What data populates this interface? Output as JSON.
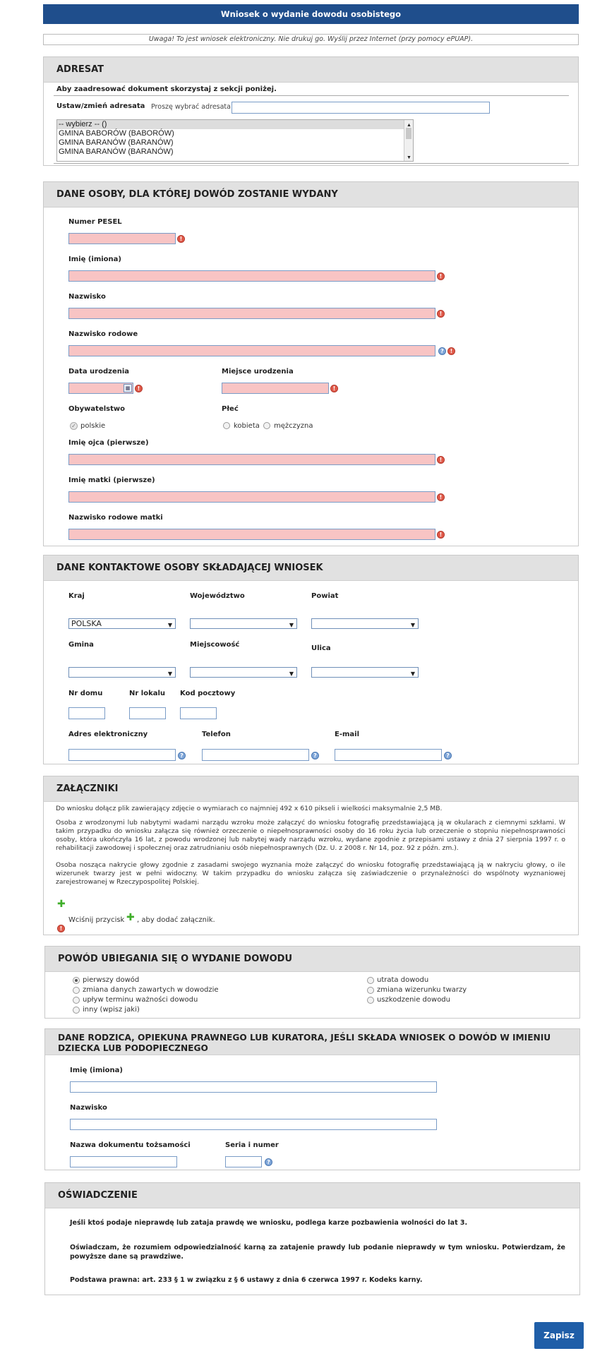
{
  "title": "Wniosek o wydanie dowodu osobistego",
  "notice": "Uwaga! To jest wniosek elektroniczny. Nie drukuj go. Wyślij przez Internet (przy pomocy ePUAP).",
  "adresat": {
    "header": "ADRESAT",
    "hint": "Aby zaadresować dokument skorzystaj z sekcji poniżej.",
    "label": "Ustaw/zmień adresata",
    "placeholder": "Proszę wybrać adresata",
    "options": [
      "-- wybierz -- ()",
      "GMINA BABORÓW (BABORÓW)",
      "GMINA BARANÓW (BARANÓW)",
      "GMINA BARANÓW (BARANÓW)"
    ]
  },
  "person": {
    "header": "DANE OSOBY, DLA KTÓREJ DOWÓD ZOSTANIE WYDANY",
    "pesel": "Numer PESEL",
    "first_name": "Imię (imiona)",
    "last_name": "Nazwisko",
    "family_name": "Nazwisko rodowe",
    "birth_date": "Data urodzenia",
    "birth_place": "Miejsce urodzenia",
    "citizenship": "Obywatelstwo",
    "citizenship_value": "polskie",
    "sex": "Płeć",
    "sex_female": "kobieta",
    "sex_male": "mężczyzna",
    "father": "Imię ojca (pierwsze)",
    "mother": "Imię matki (pierwsze)",
    "mother_family": "Nazwisko rodowe matki"
  },
  "contact": {
    "header": "DANE KONTAKTOWE OSOBY SKŁADAJĄCEJ WNIOSEK",
    "country": "Kraj",
    "country_value": "POLSKA",
    "voivodeship": "Województwo",
    "county": "Powiat",
    "commune": "Gmina",
    "locality": "Miejscowość",
    "street": "Ulica",
    "house_no": "Nr domu",
    "flat_no": "Nr lokalu",
    "postal": "Kod pocztowy",
    "eaddress": "Adres elektroniczny",
    "phone": "Telefon",
    "email": "E-mail"
  },
  "attachments": {
    "header": "ZAŁĄCZNIKI",
    "p1": "Do wniosku dołącz plik zawierający zdjęcie o wymiarach co najmniej 492 x 610 pikseli i wielkości maksymalnie 2,5 MB.",
    "p2": "Osoba z wrodzonymi lub nabytymi wadami narządu wzroku może załączyć do wniosku fotografię przedstawiającą ją w okularach z ciemnymi szkłami. W takim przypadku do wniosku załącza się również orzeczenie o niepełnosprawności osoby do 16 roku życia lub orzeczenie o stopniu niepełnosprawności osoby, która ukończyła 16 lat, z powodu wrodzonej lub nabytej wady narządu wzroku, wydane zgodnie z przepisami ustawy z dnia 27 sierpnia 1997 r. o rehabilitacji zawodowej i społecznej oraz zatrudnianiu osób niepełnosprawnych (Dz. U. z 2008 r. Nr 14, poz. 92 z późn. zm.).",
    "p3": "Osoba nosząca nakrycie głowy zgodnie z zasadami swojego wyznania może załączyć do wniosku fotografię przedstawiającą ją w nakryciu głowy, o ile wizerunek twarzy jest w pełni widoczny. W takim przypadku do wniosku załącza się zaświadczenie o przynależności do wspólnoty wyznaniowej zarejestrowanej w Rzeczypospolitej Polskiej.",
    "add_pre": "Wciśnij przycisk",
    "add_post": ", aby dodać załącznik."
  },
  "reason": {
    "header": "POWÓD UBIEGANIA SIĘ O WYDANIE DOWODU",
    "left": [
      "pierwszy dowód",
      "zmiana danych zawartych w dowodzie",
      "upływ terminu ważności dowodu",
      "inny (wpisz jaki)"
    ],
    "right": [
      "utrata dowodu",
      "zmiana wizerunku twarzy",
      "uszkodzenie dowodu"
    ]
  },
  "parent": {
    "header1": "DANE RODZICA, OPIEKUNA PRAWNEGO LUB KURATORA, JEŚLI SKŁADA WNIOSEK O DOWÓD W IMIENIU",
    "header2": "DZIECKA LUB PODOPIECZNEGO",
    "first_name": "Imię (imiona)",
    "last_name": "Nazwisko",
    "doc_name": "Nazwa dokumentu tożsamości",
    "doc_no": "Seria i numer"
  },
  "declaration": {
    "header": "OŚWIADCZENIE",
    "l1": "Jeśli ktoś podaje nieprawdę lub zataja prawdę we wniosku, podlega karze pozbawienia wolności do lat 3.",
    "l2": "Oświadczam, że rozumiem odpowiedzialność karną za zatajenie prawdy lub podanie nieprawdy w tym wniosku. Potwierdzam, że powyższe dane są prawdziwe.",
    "l3": "Podstawa prawna: art. 233 § 1 w związku z § 6 ustawy z dnia 6 czerwca 1997 r. Kodeks karny."
  },
  "save_label": "Zapisz"
}
